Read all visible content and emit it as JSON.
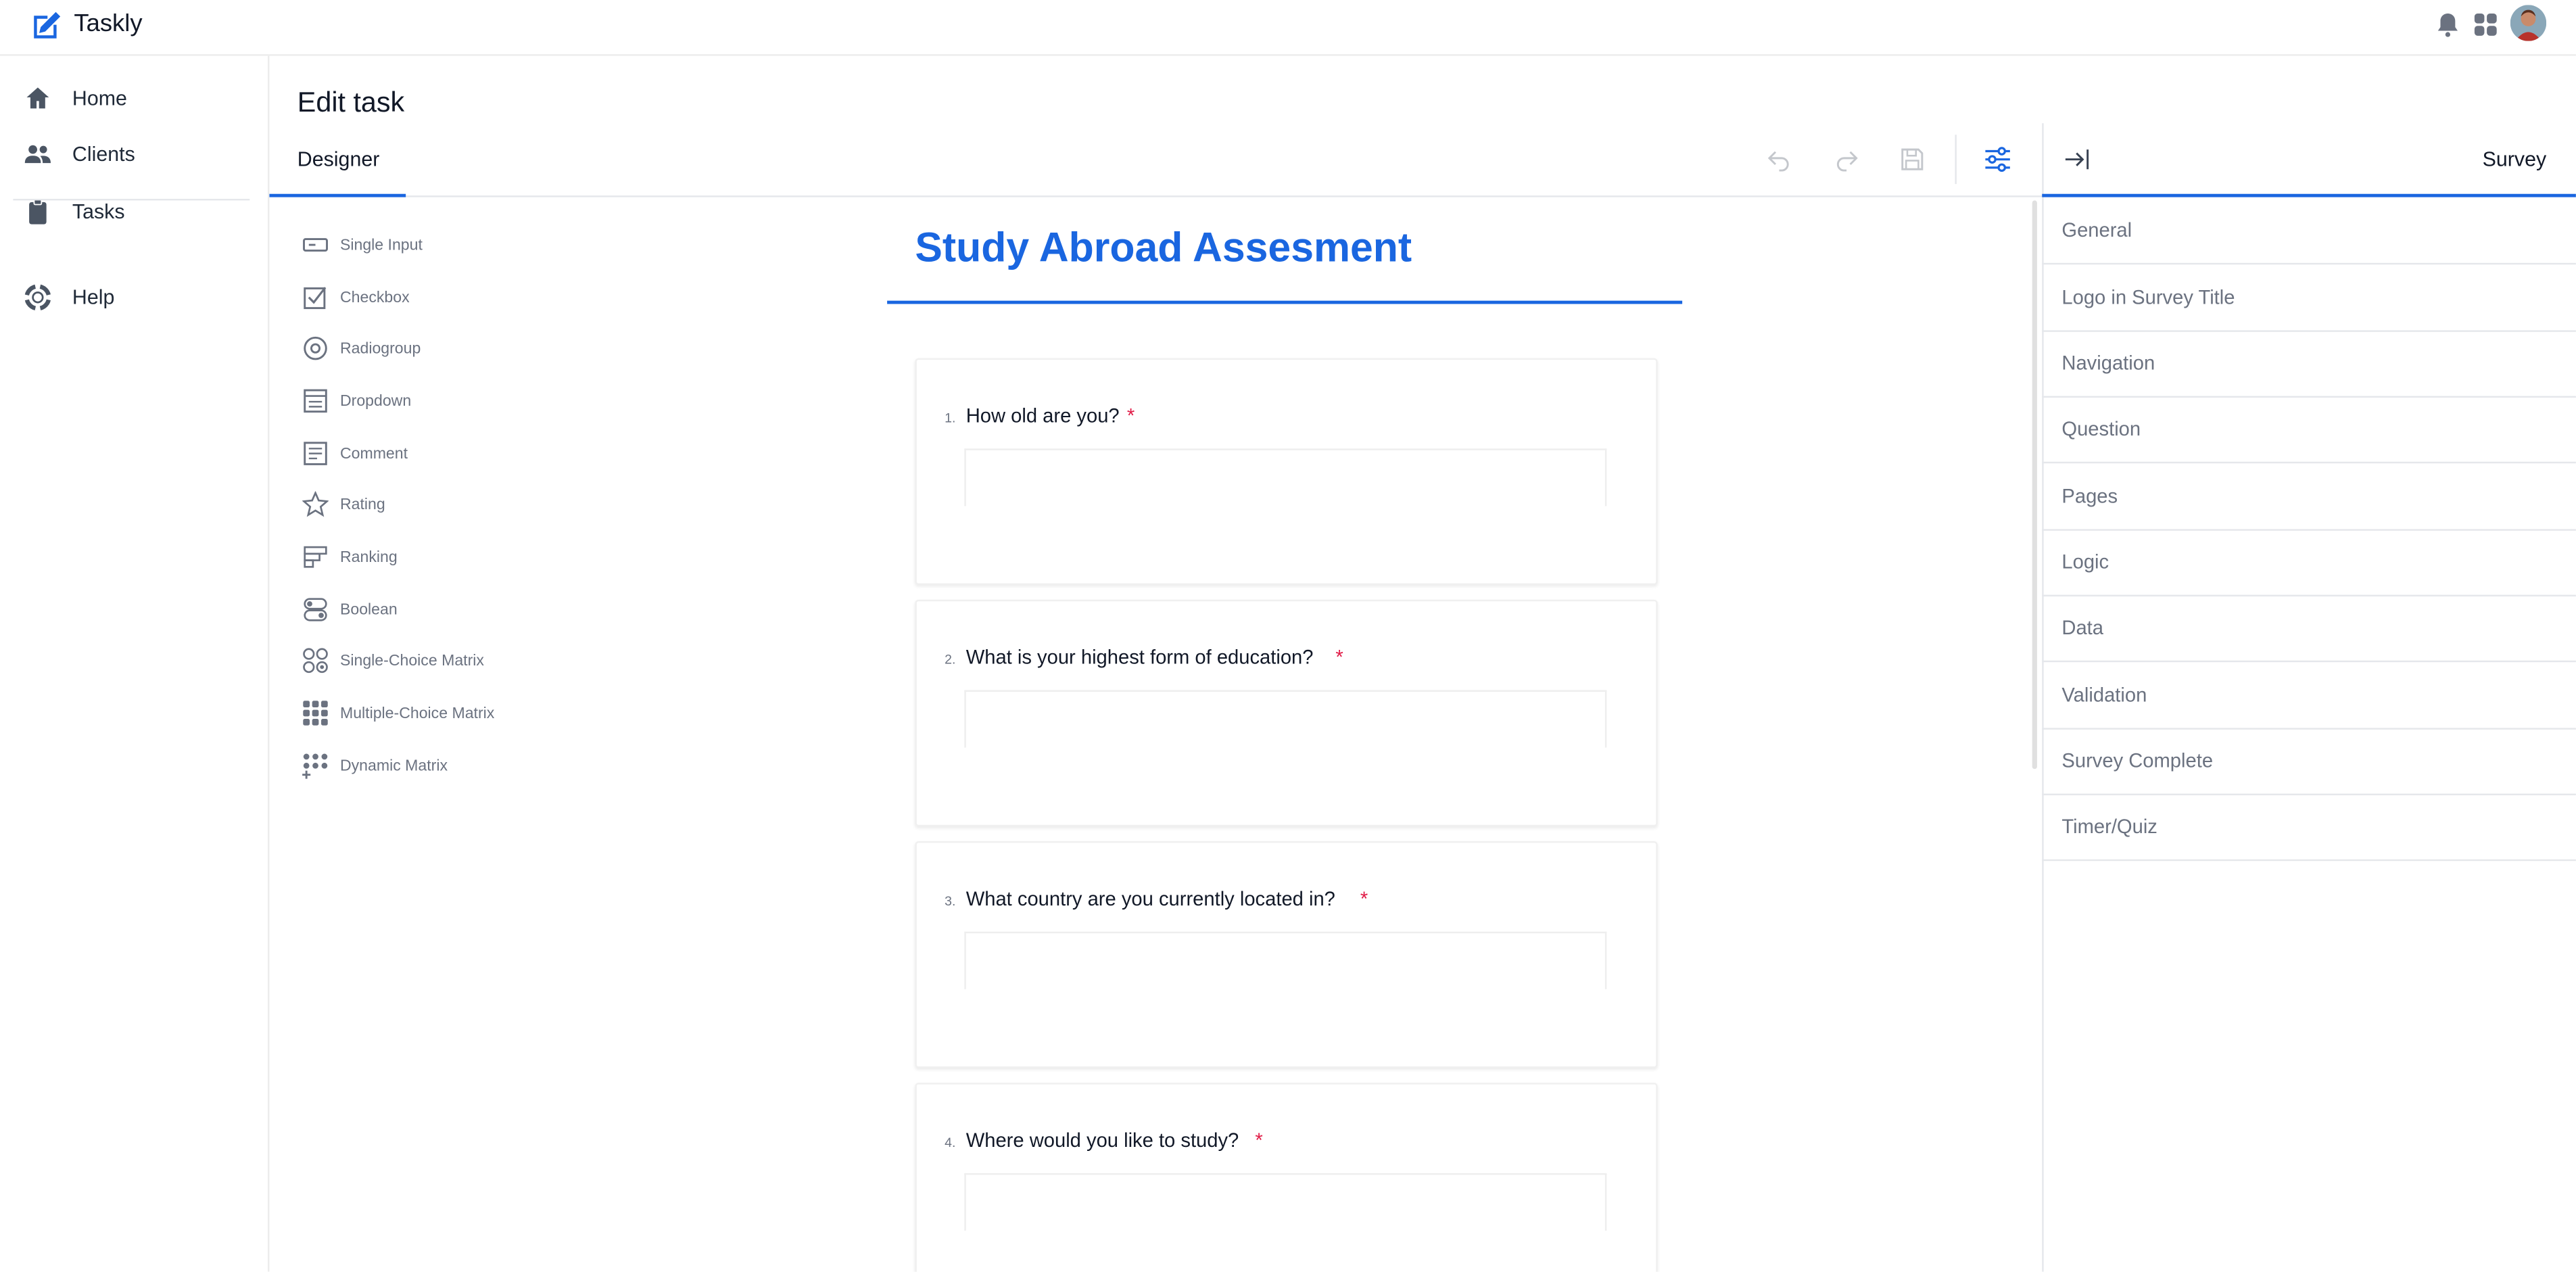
{
  "app": {
    "name": "Taskly"
  },
  "header": {
    "icons": [
      "bell-icon",
      "apps-grid-icon",
      "user-avatar"
    ]
  },
  "sidebar": {
    "items": [
      {
        "label": "Home",
        "icon": "home-icon"
      },
      {
        "label": "Clients",
        "icon": "users-icon"
      },
      {
        "label": "Tasks",
        "icon": "clipboard-icon"
      },
      {
        "label": "Help",
        "icon": "lifebuoy-icon"
      }
    ]
  },
  "page": {
    "title": "Edit task"
  },
  "tabs": {
    "designer": "Designer"
  },
  "toolbar": {
    "icons": [
      "undo-icon",
      "redo-icon",
      "save-icon",
      "settings-sliders-icon"
    ]
  },
  "toolbox": {
    "items": [
      {
        "label": "Single Input",
        "icon": "single-input-icon"
      },
      {
        "label": "Checkbox",
        "icon": "checkbox-icon"
      },
      {
        "label": "Radiogroup",
        "icon": "radiogroup-icon"
      },
      {
        "label": "Dropdown",
        "icon": "dropdown-icon"
      },
      {
        "label": "Comment",
        "icon": "comment-icon"
      },
      {
        "label": "Rating",
        "icon": "rating-star-icon"
      },
      {
        "label": "Ranking",
        "icon": "ranking-icon"
      },
      {
        "label": "Boolean",
        "icon": "boolean-icon"
      },
      {
        "label": "Single-Choice Matrix",
        "icon": "single-choice-matrix-icon"
      },
      {
        "label": "Multiple-Choice Matrix",
        "icon": "multiple-choice-matrix-icon"
      },
      {
        "label": "Dynamic Matrix",
        "icon": "dynamic-matrix-icon"
      }
    ]
  },
  "survey": {
    "title": "Study Abroad Assesment",
    "required_mark": "*",
    "questions": [
      {
        "number": "1.",
        "text": "How old are you?"
      },
      {
        "number": "2.",
        "text": "What is your highest form of education?"
      },
      {
        "number": "3.",
        "text": "What country are you currently located in?"
      },
      {
        "number": "4.",
        "text": "Where would you like to study?"
      }
    ]
  },
  "property_panel": {
    "title": "Survey",
    "sections": [
      "General",
      "Logo in Survey Title",
      "Navigation",
      "Question",
      "Pages",
      "Logic",
      "Data",
      "Validation",
      "Survey Complete",
      "Timer/Quiz"
    ]
  },
  "colors": {
    "accent": "#1a66e0",
    "required": "#e11d48",
    "muted_text": "#6b7280"
  }
}
